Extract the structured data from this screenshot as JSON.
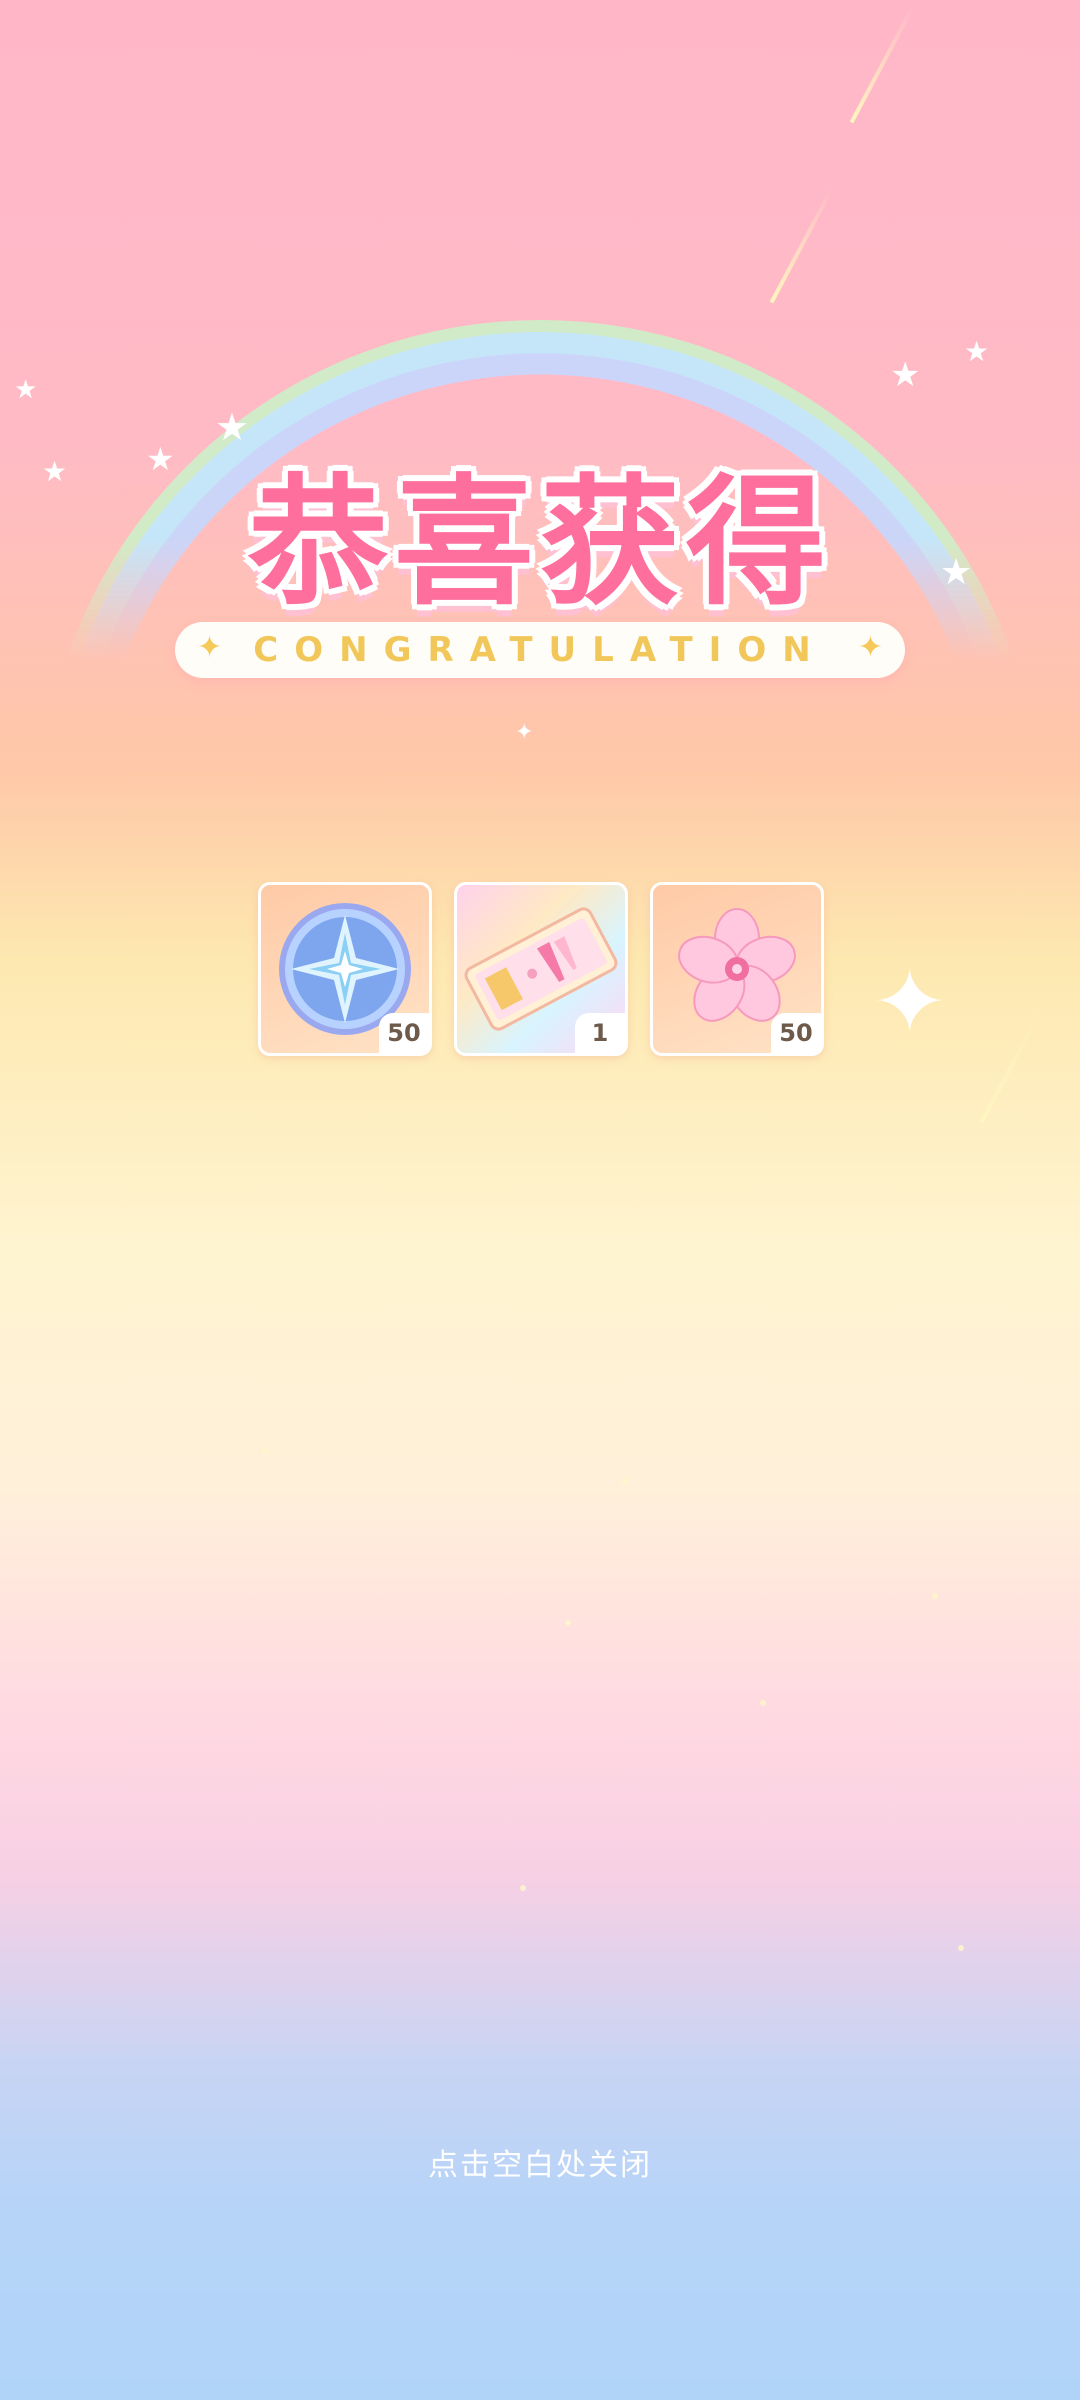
{
  "header": {
    "title": "恭喜获得",
    "subtitle": "CONGRATULATION"
  },
  "rewards": [
    {
      "name": "compass-medal",
      "count": "50"
    },
    {
      "name": "ticket",
      "count": "1"
    },
    {
      "name": "sakura-flower",
      "count": "50"
    }
  ],
  "footer": {
    "close_hint": "点击空白处关闭"
  },
  "colors": {
    "title_pink": "#ff6f9e",
    "subtitle_gold": "#f2c75a",
    "hint_white": "#ffffff"
  }
}
